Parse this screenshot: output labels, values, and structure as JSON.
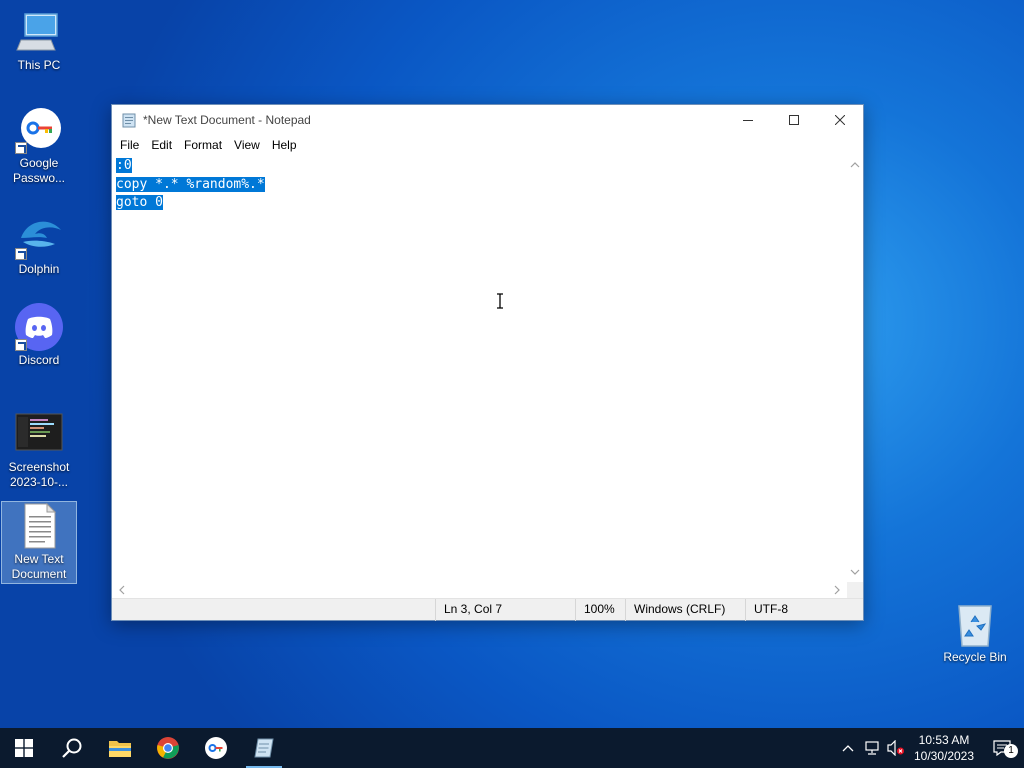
{
  "desktop": {
    "icons": [
      {
        "label": "This PC"
      },
      {
        "label": "Google Passwo..."
      },
      {
        "label": "Dolphin"
      },
      {
        "label": "Discord"
      },
      {
        "label": "Screenshot 2023-10-..."
      },
      {
        "label": "New Text Document"
      },
      {
        "label": "Recycle Bin"
      }
    ]
  },
  "notepad": {
    "title": "*New Text Document - Notepad",
    "menu": [
      "File",
      "Edit",
      "Format",
      "View",
      "Help"
    ],
    "lines": [
      ":0",
      "copy *.* %random%.*",
      "goto 0"
    ],
    "status": {
      "position": "Ln 3, Col 7",
      "zoom": "100%",
      "line_ending": "Windows (CRLF)",
      "encoding": "UTF-8"
    }
  },
  "taskbar": {
    "time": "10:53 AM",
    "date": "10/30/2023",
    "notification_count": "1"
  },
  "colors": {
    "selection": "#0078d7",
    "taskbar": "#0b1a2e",
    "accent": "#76b9ed"
  }
}
